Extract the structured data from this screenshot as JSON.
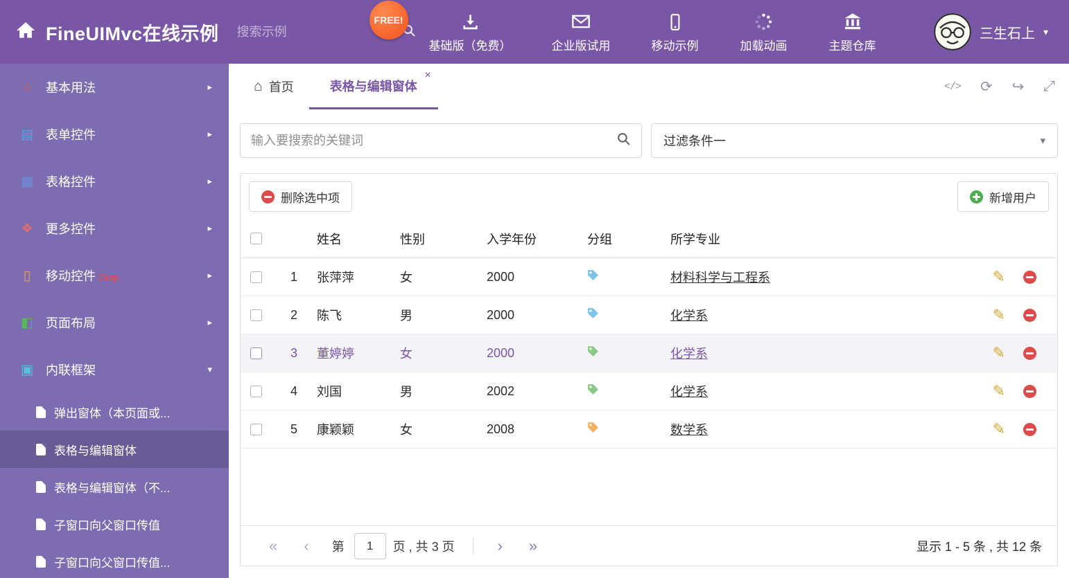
{
  "colors": {
    "header_bg": "#7a57a6",
    "sidebar_bg": "#7d6cb2",
    "accent_purple": "#7a57a6",
    "free_badge": "#f4511e",
    "delete_red": "#dd4b4b",
    "add_green": "#4cae4c",
    "corp_red": "#ff3b30"
  },
  "icons": {
    "chevron_right": "▸",
    "chevron_down": "▾",
    "caret_down": "▾",
    "home_tab": "⌂",
    "close": "×",
    "code": "</>",
    "refresh": "⟳",
    "forward": "↪",
    "expand": "⤢",
    "pencil": "✎",
    "pager_first": "«",
    "pager_prev": "‹",
    "pager_next": "›",
    "pager_last": "»"
  },
  "header": {
    "title": "FineUIMvc在线示例",
    "search_placeholder": "搜索示例",
    "free_badge": "FREE!",
    "nav": [
      {
        "label": "基础版（免费）",
        "icon": "download-icon"
      },
      {
        "label": "企业版试用",
        "icon": "envelope-icon"
      },
      {
        "label": "移动示例",
        "icon": "mobile-icon"
      },
      {
        "label": "加载动画",
        "icon": "spinner-icon"
      },
      {
        "label": "主题仓库",
        "icon": "bank-icon"
      }
    ],
    "user_name": "三生石上"
  },
  "sidebar": {
    "items": [
      {
        "label": "基本用法",
        "glyph": "⌂",
        "color": "#e2574c"
      },
      {
        "label": "表单控件",
        "glyph": "▤",
        "color": "#56a3e0"
      },
      {
        "label": "表格控件",
        "glyph": "▦",
        "color": "#6f8fd8"
      },
      {
        "label": "更多控件",
        "glyph": "❖",
        "color": "#e06c6c"
      },
      {
        "label": "移动控件",
        "glyph": "▯",
        "color": "#f0a04a",
        "badge": "Corp."
      },
      {
        "label": "页面布局",
        "glyph": "◧",
        "color": "#58b85c"
      },
      {
        "label": "内联框架",
        "glyph": "▣",
        "color": "#5bc0de"
      }
    ],
    "subitems": [
      {
        "label": "弹出窗体（本页面或..."
      },
      {
        "label": "表格与编辑窗体",
        "active": true
      },
      {
        "label": "表格与编辑窗体（不..."
      },
      {
        "label": "子窗口向父窗口传值"
      },
      {
        "label": "子窗口向父窗口传值..."
      }
    ]
  },
  "tabs": {
    "home_label": "首页",
    "active_label": "表格与编辑窗体"
  },
  "filter": {
    "search_placeholder": "输入要搜索的关键词",
    "dropdown_value": "过滤条件一"
  },
  "toolbar": {
    "delete_label": "删除选中项",
    "add_label": "新增用户"
  },
  "table": {
    "columns": {
      "name": "姓名",
      "gender": "性别",
      "year": "入学年份",
      "group": "分组",
      "major": "所学专业"
    },
    "rows": [
      {
        "num": "1",
        "name": "张萍萍",
        "gender": "女",
        "year": "2000",
        "tag_color": "#7ec4e8",
        "major": "材料科学与工程系"
      },
      {
        "num": "2",
        "name": "陈飞",
        "gender": "男",
        "year": "2000",
        "tag_color": "#7ec4e8",
        "major": "化学系"
      },
      {
        "num": "3",
        "name": "董婷婷",
        "gender": "女",
        "year": "2000",
        "tag_color": "#8bc98b",
        "major": "化学系",
        "selected": true
      },
      {
        "num": "4",
        "name": "刘国",
        "gender": "男",
        "year": "2002",
        "tag_color": "#8bc98b",
        "major": "化学系"
      },
      {
        "num": "5",
        "name": "康颖颖",
        "gender": "女",
        "year": "2008",
        "tag_color": "#f2b064",
        "major": "数学系"
      }
    ]
  },
  "pagination": {
    "prefix": "第",
    "current_page": "1",
    "suffix": "页 , 共 3 页",
    "summary": "显示 1 - 5 条 , 共 12 条"
  }
}
